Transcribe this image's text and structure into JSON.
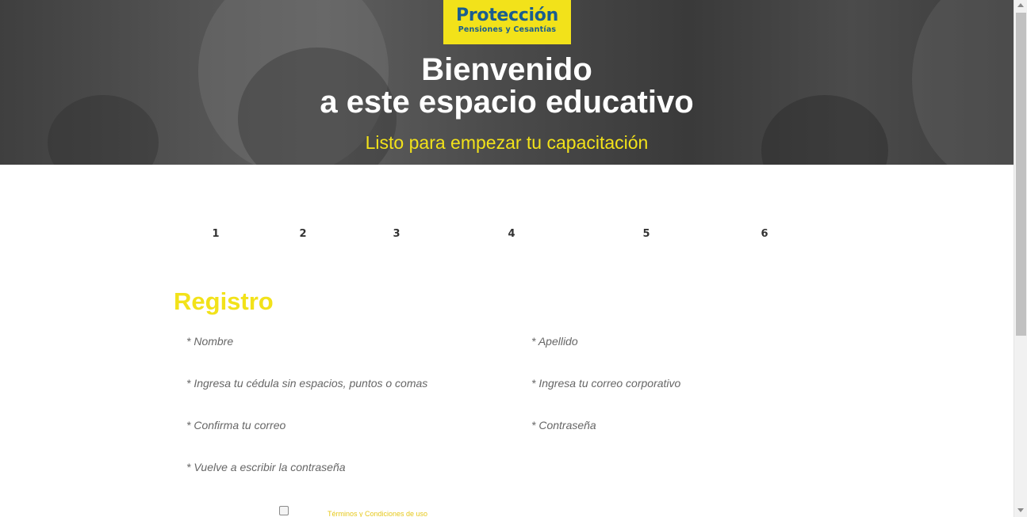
{
  "header": {
    "logo_name": "Protección",
    "logo_subtitle": "Pensiones y Cesantías",
    "title_line1": "Bienvenido",
    "title_line2": "a este espacio educativo",
    "subtitle": "Listo para empezar tu capacitación"
  },
  "steps": [
    "1",
    "2",
    "3",
    "4",
    "5",
    "6"
  ],
  "form": {
    "title": "Registro",
    "fields": {
      "nombre": "* Nombre",
      "apellido": "* Apellido",
      "cedula": "* Ingresa tu cédula sin espacios, puntos o comas",
      "correo": "* Ingresa tu correo corporativo",
      "confirma_correo": "* Confirma tu correo",
      "contrasena": "* Contraseña",
      "repite_contrasena": "* Vuelve a escribir la contraseña"
    },
    "terms_label": "Términos y Condiciones de uso"
  },
  "colors": {
    "brand_yellow": "#f2e21a",
    "brand_blue": "#1a5d8f"
  }
}
